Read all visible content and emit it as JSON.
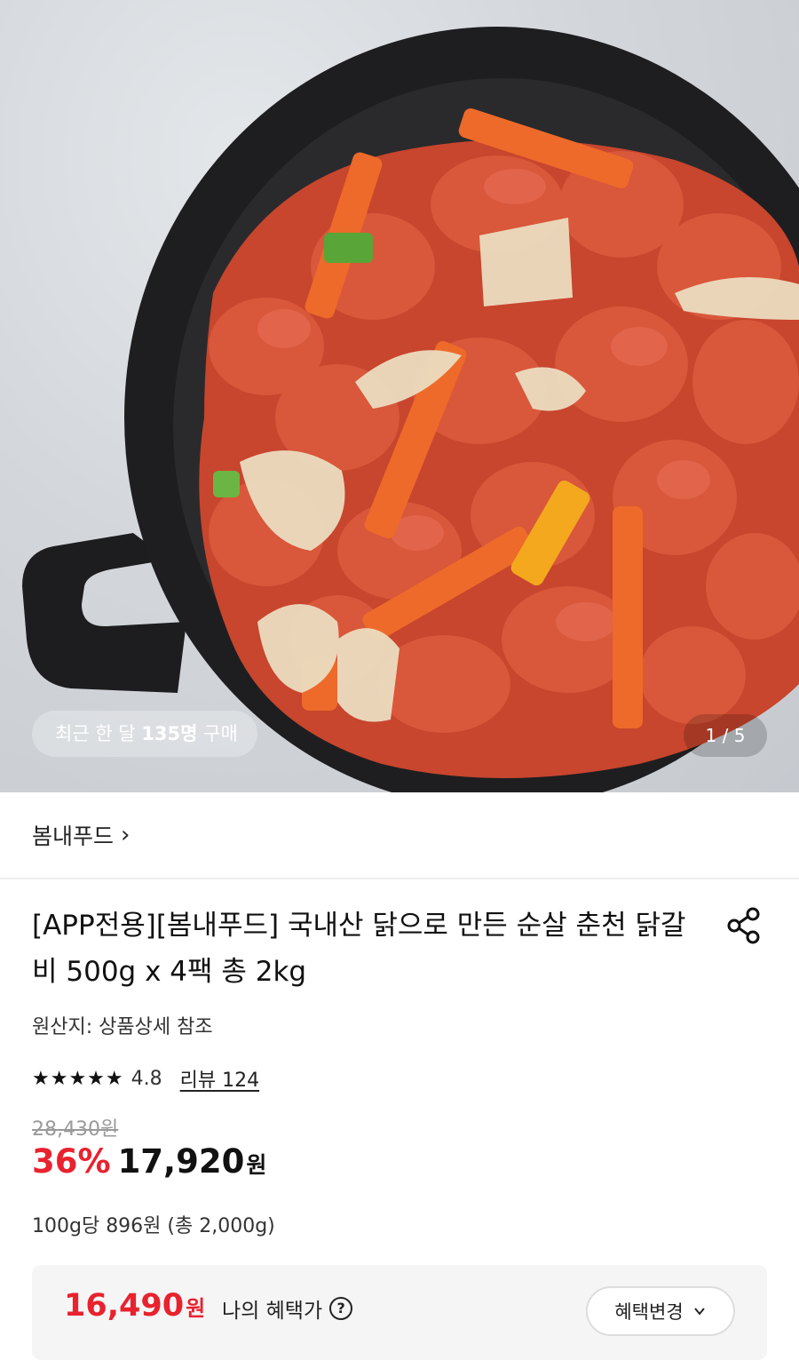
{
  "hero": {
    "purchase_prefix": "최근 한 달 ",
    "purchase_count": "135명",
    "purchase_suffix": " 구매",
    "image_counter": "1 / 5"
  },
  "brand": {
    "name": "봄내푸드",
    "chevron": "›"
  },
  "product": {
    "title": "[APP전용][봄내푸드] 국내산 닭으로 만든 순살 춘천 닭갈비 500g x 4팩 총 2kg",
    "origin": "원산지: 상품상세 참조",
    "stars": "★★★★★",
    "rating": "4.8",
    "review_link": "리뷰 124",
    "original_price": "28,430원",
    "discount": "36%",
    "price": "17,920",
    "price_unit": "원",
    "unit_price": "100g당 896원 (총 2,000g)"
  },
  "benefit": {
    "price": "16,490",
    "price_unit": "원",
    "label": "나의 혜택가",
    "help": "?",
    "change_button": "혜택변경"
  },
  "icons": {
    "share": "share-icon",
    "chevron": "chevron-down-icon",
    "star": "star-icon"
  },
  "colors": {
    "accent_red": "#e8222e",
    "text": "#111111",
    "muted": "#9a9a9a",
    "benefit_bg": "#f5f5f6"
  }
}
